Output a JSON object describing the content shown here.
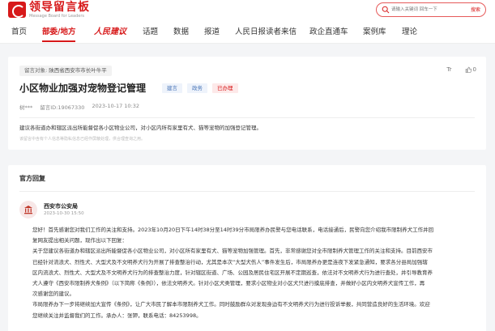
{
  "header": {
    "logo_title": "领导留言板",
    "logo_subtitle": "Message Board for Leaders",
    "search_placeholder": "请输入关键词 回车一下",
    "search_button": "搜索"
  },
  "nav": {
    "items": [
      "首页",
      "部委/地方",
      "人民建议",
      "话题",
      "数据",
      "报道",
      "人民日报读者来信",
      "政企直通车",
      "案例库",
      "理论"
    ],
    "active_index": 1
  },
  "message": {
    "recipient_label": "留言对象:",
    "recipient_value": "陕西省西安市市长叶牛平",
    "font_toggle": "Tr",
    "like_count": "0",
    "title": "小区物业加强对宠物登记管理",
    "tags": [
      "建言",
      "政务",
      "已办理"
    ],
    "author": "树***",
    "message_id": "留言ID:19067330",
    "datetime": "2023-10-17 10:32",
    "content": "建议各街道办和辖区派出所能督促各小区物业公司，对小区内所有家里有犬、猫等宠物的加强登记管理。",
    "disclaimer": "该留言中含有个人信息等隐私信息已经作屏蔽处理，供合理查询之用。"
  },
  "reply": {
    "section_title": "官方回复",
    "org_name": "西安市公安局",
    "org_time": "2023-10-30 15:50",
    "lines": [
      "您好！首先感谢您对我们工作的关注和支持。2023年10月20日下午14时38分至14时39分市局限养办民警与您电话联系，电话接通后，民警向您介绍我市限制养犬工作并回",
      "复网友提出相关问题，现作出以下回复：",
      "关于您建议各街道办和辖区派出所能督促各小区物业公司，对小区所有家里有犬、猫等宠物加强管理。首先，非常感谢您对全市限制养犬管理工作的关注和支持。目前西安市",
      "已经针对流浪犬、烈性犬、大型犬及不文明养犬行为开展了排查整治行动，尤其是本次“大型犬伤人”事件发生后，市局限养办更是连夜下发紧急通知，要求各分县局加强辖",
      "区内流浪犬、烈性犬、大型犬及不文明养犬行为的排查整治力度，针对辖区街道、广场、公园及居民住宅区开展不定期巡查，依法对不文明养犬行为进行查处，并引导教育养",
      "犬人遵守《西安市限制养犬条例》（以下简称《条例》），依法文明养犬。针对小区犬类管理，要求小区物业对小区犬只进行摸底排查，并做好小区内文明养犬宣传工作，再",
      "次感谢您的建议。",
      "市局限养办下一步将继续加大宣传《条例》，让广大市民了解本市限制养犬工作。同时鼓励群众对发现身边有不文明养犬行为进行投诉举报，共同营造良好的生活环境。欢迎",
      "您继续关注并监督我们的工作。承办人：张钾，联系电话：84253998。"
    ]
  }
}
